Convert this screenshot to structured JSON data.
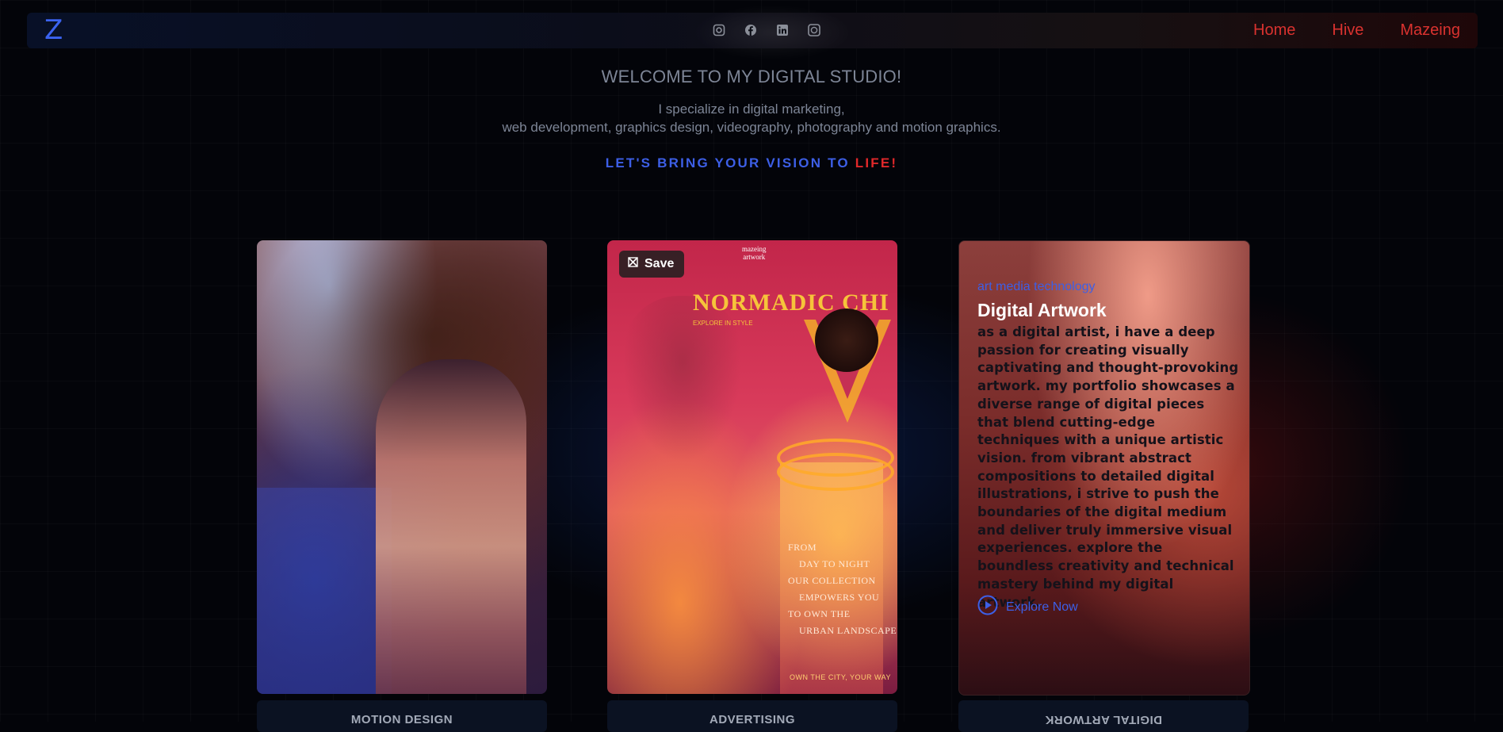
{
  "nav": {
    "logo": "Z",
    "socials": [
      "instagram-icon",
      "facebook-icon",
      "linkedin-icon",
      "whatsapp-icon"
    ],
    "links": [
      "Home",
      "Hive",
      "Mazeing"
    ]
  },
  "hero": {
    "title": "WELCOME TO MY DIGITAL STUDIO!",
    "subtitle_line1": "I specialize in digital marketing,",
    "subtitle_line2": "web development, graphics design, videography, photography and motion graphics.",
    "cta_blue": "LET'S BRING YOUR VISION TO ",
    "cta_red": "LIFE!"
  },
  "cards": [
    {
      "label": "MOTION DESIGN"
    },
    {
      "label": "ADVERTISING",
      "save_label": "Save",
      "poster": {
        "brand_line1": "mazeing",
        "brand_line2": "artwork",
        "title": "NORMADIC CHI",
        "tagline": "EXPLORE IN STYLE",
        "text": "FROM\n    DAY TO NIGHT\nOUR COLLECTION\n    EMPOWERS YOU\nTO OWN THE\n    URBAN LANDSCAPE",
        "footer": "OWN THE CITY, YOUR WAY"
      }
    },
    {
      "label": "DIGITAL ARTWORK",
      "kicker": "art media technology",
      "title": "Digital Artwork",
      "description": "as a digital artist, i have a deep passion for creating visually captivating and thought-provoking artwork. my portfolio showcases a diverse range of digital pieces that blend cutting-edge techniques with a unique artistic vision. from vibrant abstract compositions to detailed digital illustrations, i strive to push the boundaries of the digital medium and deliver truly immersive visual experiences. explore the boundless creativity and technical mastery behind my digital artwork.",
      "explore_label": "Explore Now"
    }
  ],
  "colors": {
    "accent_blue": "#3d5fe6",
    "accent_red": "#e0282a",
    "background": "#030409"
  }
}
